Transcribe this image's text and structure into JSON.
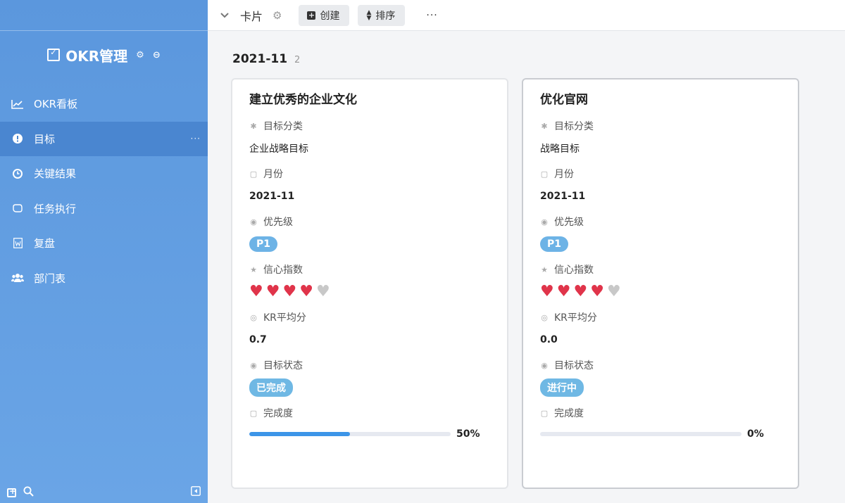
{
  "sidebar": {
    "app_title": "OKR管理",
    "items": [
      {
        "label": "OKR看板",
        "icon": "chart-line-icon",
        "active": false
      },
      {
        "label": "目标",
        "icon": "exclamation-circle-icon",
        "active": true
      },
      {
        "label": "关键结果",
        "icon": "clock-icon",
        "active": false
      },
      {
        "label": "任务执行",
        "icon": "hand-icon",
        "active": false
      },
      {
        "label": "复盘",
        "icon": "word-doc-icon",
        "active": false
      },
      {
        "label": "部门表",
        "icon": "users-icon",
        "active": false
      }
    ],
    "more": "···"
  },
  "toolbar": {
    "view_name": "卡片",
    "create_label": "创建",
    "sort_label": "排序",
    "more": "···"
  },
  "group": {
    "title": "2021-11",
    "count": "2"
  },
  "cards": [
    {
      "title": "建立优秀的企业文化",
      "category_label": "目标分类",
      "category": "企业战略目标",
      "month_label": "月份",
      "month": "2021-11",
      "priority_label": "优先级",
      "priority": "P1",
      "confidence_label": "信心指数",
      "confidence": 4,
      "confidence_max": 5,
      "kr_label": "KR平均分",
      "kr_avg": "0.7",
      "status_label": "目标状态",
      "status": "已完成",
      "progress_label": "完成度",
      "progress": 50,
      "progress_text": "50%"
    },
    {
      "title": "优化官网",
      "category_label": "目标分类",
      "category": "战略目标",
      "month_label": "月份",
      "month": "2021-11",
      "priority_label": "优先级",
      "priority": "P1",
      "confidence_label": "信心指数",
      "confidence": 4,
      "confidence_max": 5,
      "kr_label": "KR平均分",
      "kr_avg": "0.0",
      "status_label": "目标状态",
      "status": "进行中",
      "progress_label": "完成度",
      "progress": 0,
      "progress_text": "0%"
    }
  ],
  "colors": {
    "sidebar": "#5b97dd",
    "heart_on": "#e0344a",
    "heart_off": "#c8c8c8",
    "progress": "#3c95e8"
  }
}
